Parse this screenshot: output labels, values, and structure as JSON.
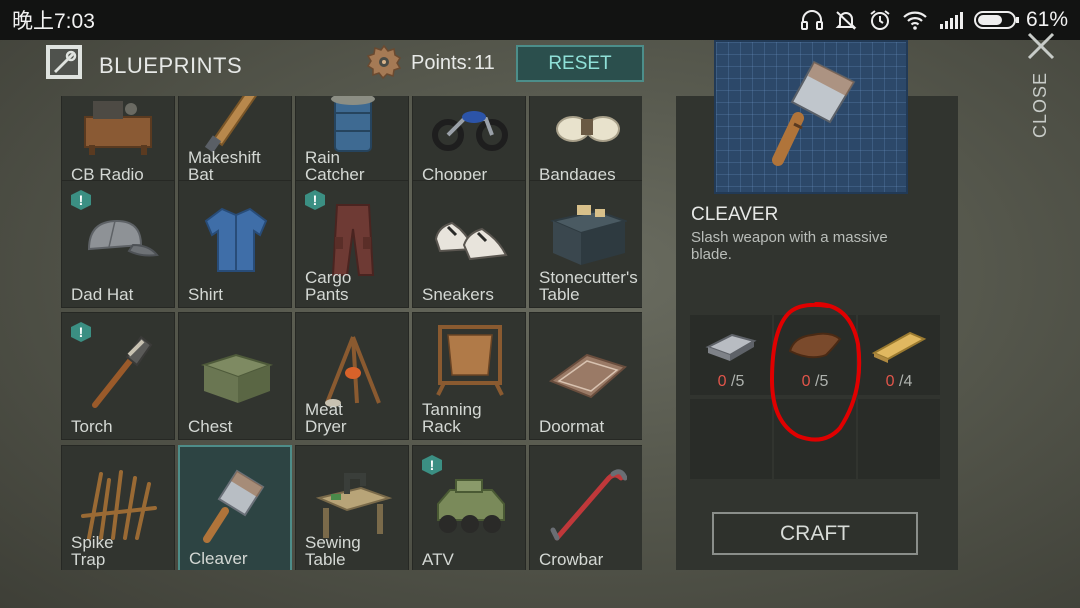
{
  "status_bar": {
    "time": "晚上7:03",
    "battery": "61%"
  },
  "header": {
    "title": "BLUEPRINTS",
    "points_label": "Points:",
    "points_value": "11",
    "reset_label": "RESET"
  },
  "grid": {
    "items": [
      {
        "label": "CB Radio",
        "icon": "cb-radio-icon",
        "badge": ""
      },
      {
        "label": "Makeshift Bat",
        "icon": "makeshift-bat-icon",
        "badge": ""
      },
      {
        "label": "Rain Catcher",
        "icon": "rain-catcher-icon",
        "badge": ""
      },
      {
        "label": "Chopper",
        "icon": "chopper-icon",
        "badge": ""
      },
      {
        "label": "Bandages",
        "icon": "bandages-icon",
        "badge": ""
      },
      {
        "label": "Dad Hat",
        "icon": "dad-hat-icon",
        "badge": "!"
      },
      {
        "label": "Shirt",
        "icon": "shirt-icon",
        "badge": ""
      },
      {
        "label": "Cargo Pants",
        "icon": "cargo-pants-icon",
        "badge": "!"
      },
      {
        "label": "Sneakers",
        "icon": "sneakers-icon",
        "badge": ""
      },
      {
        "label": "Stonecutter's Table",
        "icon": "stonecutters-table-icon",
        "badge": ""
      },
      {
        "label": "Torch",
        "icon": "torch-icon",
        "badge": "!"
      },
      {
        "label": "Chest",
        "icon": "chest-icon",
        "badge": ""
      },
      {
        "label": "Meat Dryer",
        "icon": "meat-dryer-icon",
        "badge": ""
      },
      {
        "label": "Tanning Rack",
        "icon": "tanning-rack-icon",
        "badge": ""
      },
      {
        "label": "Doormat",
        "icon": "doormat-icon",
        "badge": ""
      },
      {
        "label": "Spike Trap",
        "icon": "spike-trap-icon",
        "badge": ""
      },
      {
        "label": "Cleaver",
        "icon": "cleaver-icon",
        "badge": "",
        "selected": true
      },
      {
        "label": "Sewing Table",
        "icon": "sewing-table-icon",
        "badge": ""
      },
      {
        "label": "ATV",
        "icon": "atv-icon",
        "badge": "!"
      },
      {
        "label": "Crowbar",
        "icon": "crowbar-icon",
        "badge": ""
      }
    ]
  },
  "detail": {
    "name": "CLEAVER",
    "description": "Slash weapon with a massive blade.",
    "icon": "cleaver-icon",
    "materials": [
      {
        "icon": "iron-bar-icon",
        "have": "0",
        "need": "/5"
      },
      {
        "icon": "leather-icon",
        "have": "0",
        "need": "/5"
      },
      {
        "icon": "wood-plank-icon",
        "have": "0",
        "need": "/4"
      }
    ],
    "craft_label": "CRAFT"
  },
  "close_label": "CLOSE",
  "colors": {
    "accent_teal": "#4e8d89",
    "missing_red": "#e0554a",
    "annotation_red": "#e00000"
  }
}
